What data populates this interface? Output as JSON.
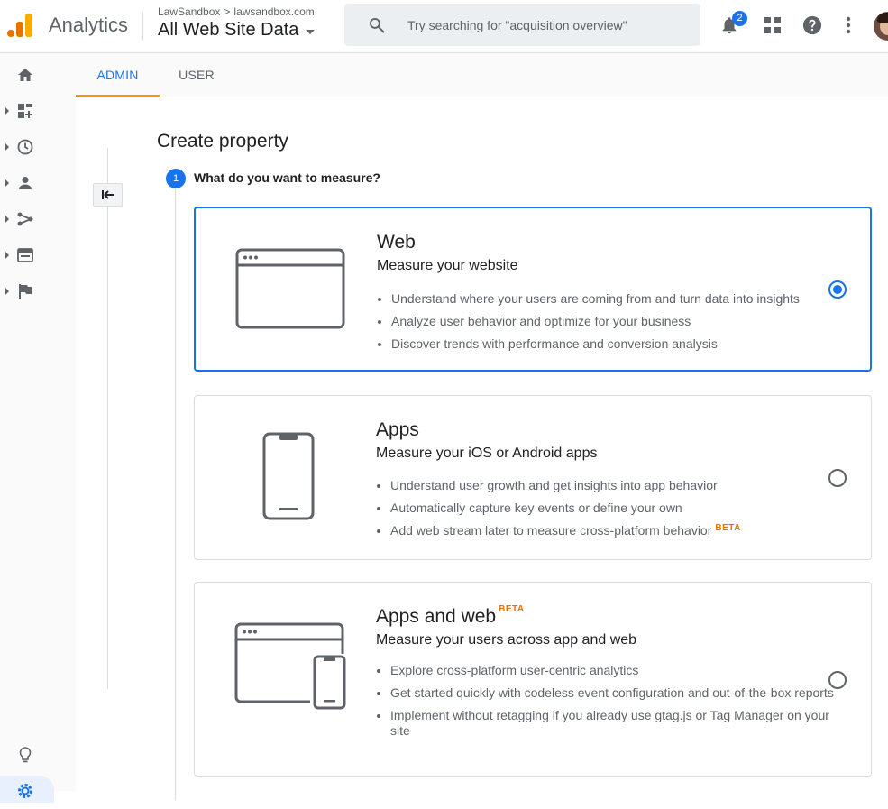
{
  "header": {
    "app_name": "Analytics",
    "breadcrumb_account": "LawSandbox",
    "breadcrumb_chevron": ">",
    "breadcrumb_property": "lawsandbox.com",
    "view_name": "All Web Site Data",
    "search_placeholder": "Try searching for \"acquisition overview\"",
    "notification_count": "2",
    "logo_colors": [
      "#f9ab00",
      "#e37400"
    ]
  },
  "tabs": [
    {
      "label": "ADMIN",
      "active": true
    },
    {
      "label": "USER",
      "active": false
    }
  ],
  "nav": {
    "icons": [
      "home-icon",
      "customization-icon",
      "realtime-icon",
      "audience-icon",
      "acquisition-icon",
      "behavior-icon",
      "conversions-icon"
    ],
    "bottom_icons": [
      "discover-icon",
      "admin-gear-icon"
    ]
  },
  "page": {
    "title": "Create property",
    "step_number": "1",
    "step_question": "What do you want to measure?"
  },
  "options": [
    {
      "title": "Web",
      "subtitle": "Measure your website",
      "bullets": [
        "Understand where your users are coming from and turn data into insights",
        "Analyze user behavior and optimize for your business",
        "Discover trends with performance and conversion analysis"
      ],
      "selected": true
    },
    {
      "title": "Apps",
      "subtitle": "Measure your iOS or Android apps",
      "bullets": [
        "Understand user growth and get insights into app behavior",
        "Automatically capture key events or define your own",
        "Add web stream later to measure cross-platform behavior"
      ],
      "bullet_badge": "BETA",
      "selected": false
    },
    {
      "title": "Apps and web",
      "title_badge": "BETA",
      "subtitle": "Measure your users across app and web",
      "bullets": [
        "Explore cross-platform user-centric analytics",
        "Get started quickly with codeless event configuration and out-of-the-box reports",
        "Implement without retagging if you already use gtag.js or Tag Manager on your site"
      ],
      "selected": false
    }
  ],
  "colors": {
    "accent": "#1a73e8",
    "beta": "#e37400",
    "tab_indicator": "#f29900"
  }
}
